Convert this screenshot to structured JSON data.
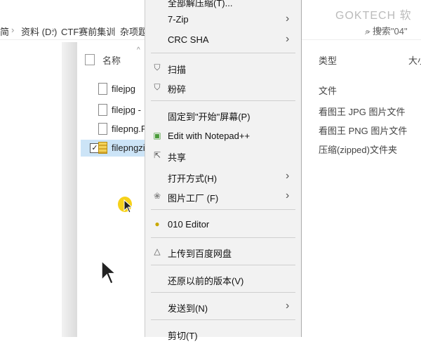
{
  "watermark": "GOKTECH 软",
  "address": {
    "seg0": "简",
    "seg1": "资料 (D:)",
    "seg2": "CTF赛前集训",
    "seg3": "杂项题"
  },
  "search": {
    "placeholder": "搜索\"04\""
  },
  "columns": {
    "name": "名称",
    "type": "类型",
    "size": "大小"
  },
  "files": [
    {
      "name": "filejpg",
      "type": "文件",
      "selected": false
    },
    {
      "name": "filejpg -",
      "type": "看图王 JPG 图片文件",
      "selected": false
    },
    {
      "name": "filepng.P",
      "type": "看图王 PNG 图片文件",
      "selected": false
    },
    {
      "name": "filepngzi",
      "type": "压缩(zipped)文件夹",
      "selected": true
    }
  ],
  "context_menu": {
    "top_partial": "全部解压缩(T)...",
    "items": [
      {
        "label": "7-Zip",
        "submenu": true,
        "icon": "none"
      },
      {
        "label": "CRC SHA",
        "submenu": true,
        "icon": "none"
      },
      {
        "label": "扫描",
        "submenu": false,
        "icon": "shield-icon"
      },
      {
        "label": "粉碎",
        "submenu": false,
        "icon": "shield-icon"
      },
      {
        "label": "固定到\"开始\"屏幕(P)",
        "submenu": false,
        "icon": "none"
      },
      {
        "label": "Edit with Notepad++",
        "submenu": false,
        "icon": "notepad-icon"
      },
      {
        "label": "共享",
        "submenu": false,
        "icon": "share-icon"
      },
      {
        "label": "打开方式(H)",
        "submenu": true,
        "icon": "none"
      },
      {
        "label": "图片工厂 (F)",
        "submenu": true,
        "icon": "picture-factory-icon"
      },
      {
        "label": "010 Editor",
        "submenu": false,
        "icon": "editor-icon"
      },
      {
        "label": "上传到百度网盘",
        "submenu": false,
        "icon": "cloud-upload-icon"
      },
      {
        "label": "还原以前的版本(V)",
        "submenu": false,
        "icon": "none"
      },
      {
        "label": "发送到(N)",
        "submenu": true,
        "icon": "none"
      },
      {
        "label": "剪切(T)",
        "submenu": false,
        "icon": "none"
      }
    ]
  }
}
